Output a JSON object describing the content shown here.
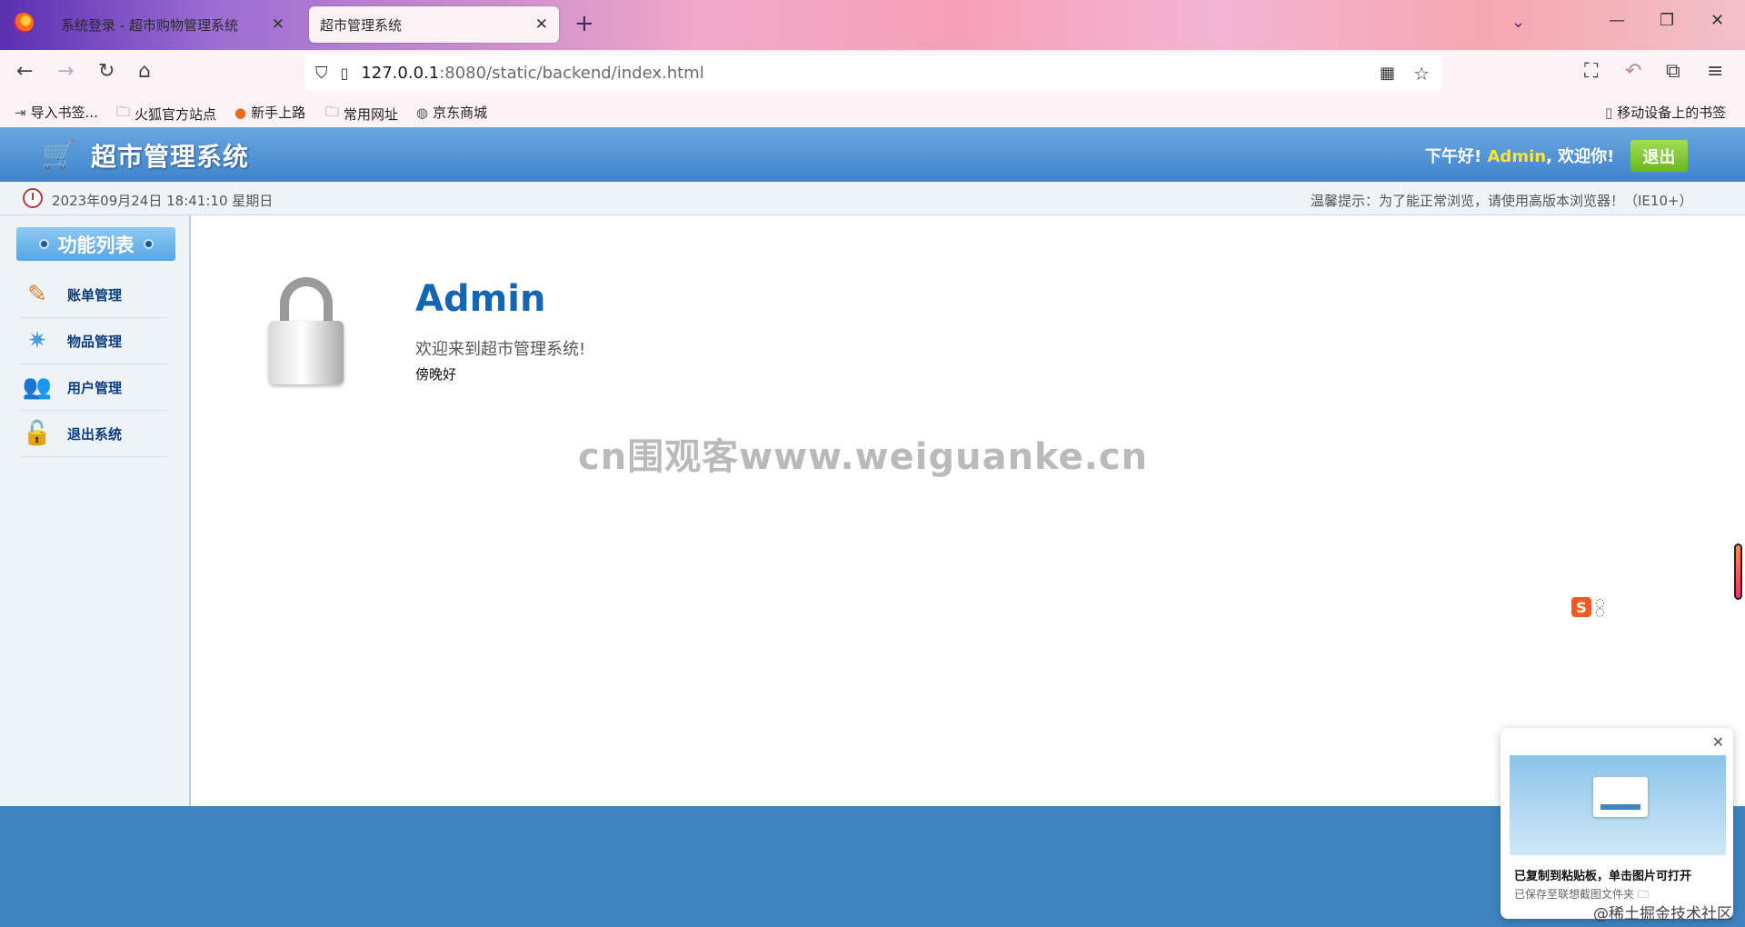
{
  "browser": {
    "tabs": [
      {
        "title": "系统登录 - 超市购物管理系统",
        "close": "✕"
      },
      {
        "title": "超市管理系统",
        "close": "✕"
      }
    ],
    "new_tab": "+",
    "url_host": "127.0.0.1",
    "url_rest": ":8080/static/backend/index.html",
    "bookmarks": [
      "导入书签...",
      "火狐官方站点",
      "新手上路",
      "常用网址",
      "京东商城"
    ],
    "mobile_bookmarks": "移动设备上的书签"
  },
  "header": {
    "title": "超市管理系统",
    "greeting": "下午好!",
    "user": "Admin",
    "welcome_suffix": ", 欢迎你!",
    "logout": "退出"
  },
  "info_bar": {
    "datetime": "2023年09月24日 18:41:10 星期日",
    "tip": "温馨提示：为了能正常浏览，请使用高版本浏览器！（IE10+）"
  },
  "sidebar": {
    "title": "功能列表",
    "items": [
      {
        "label": "账单管理",
        "icon": "bill-icon"
      },
      {
        "label": "物品管理",
        "icon": "goods-icon"
      },
      {
        "label": "用户管理",
        "icon": "users-icon"
      },
      {
        "label": "退出系统",
        "icon": "logout-icon"
      }
    ]
  },
  "main": {
    "user_name": "Admin",
    "welcome_text": "欢迎来到超市管理系统!",
    "time_greeting": "傍晚好"
  },
  "watermark": "cn围观客www.weiguanke.cn",
  "toast": {
    "title": "已复制到粘贴板，单击图片可打开",
    "subtitle": "已保存至联想截图文件夹 🗀",
    "close": "✕"
  },
  "corner_mark": "@稀土掘金技术社区"
}
